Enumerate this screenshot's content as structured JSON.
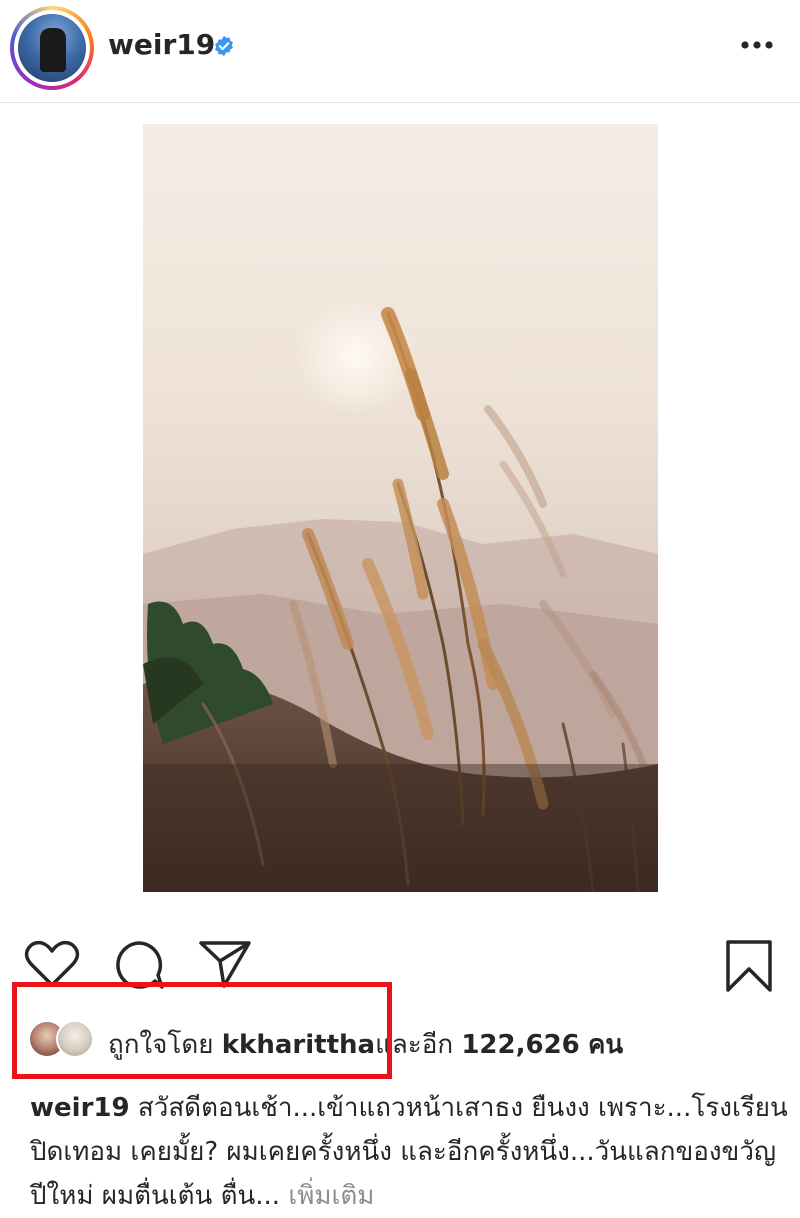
{
  "post": {
    "username": "weir19",
    "verified": true,
    "header_icons": {
      "avatar": "profile-avatar",
      "verified": "verified-badge-icon",
      "more": "more-options-icon"
    },
    "actions": {
      "like": "heart-icon",
      "comment": "comment-icon",
      "share": "send-icon",
      "save": "bookmark-icon"
    },
    "likes": {
      "prefix": "ถูกใจโดย",
      "user": "kkharittha",
      "middle": "และอีก",
      "count": "122,626",
      "suffix": "คน"
    },
    "caption": {
      "username": "weir19",
      "text": "สวัสดีตอนเช้า...เข้าแถวหน้าเสาธง ยืนงง เพราะ...โรงเรียนปิดเทอม เคยมั้ย? ผมเคยครั้งหนึ่ง และอีกครั้งหนึ่ง...วันแลกของขวัญปีใหม่ ผมตื่นเต้น ตื่น...",
      "more": "เพิ่มเติม"
    }
  },
  "colors": {
    "verified": "#3897f0",
    "highlight": "#e8141a",
    "text": "#262626",
    "muted": "#8e8e8e"
  }
}
